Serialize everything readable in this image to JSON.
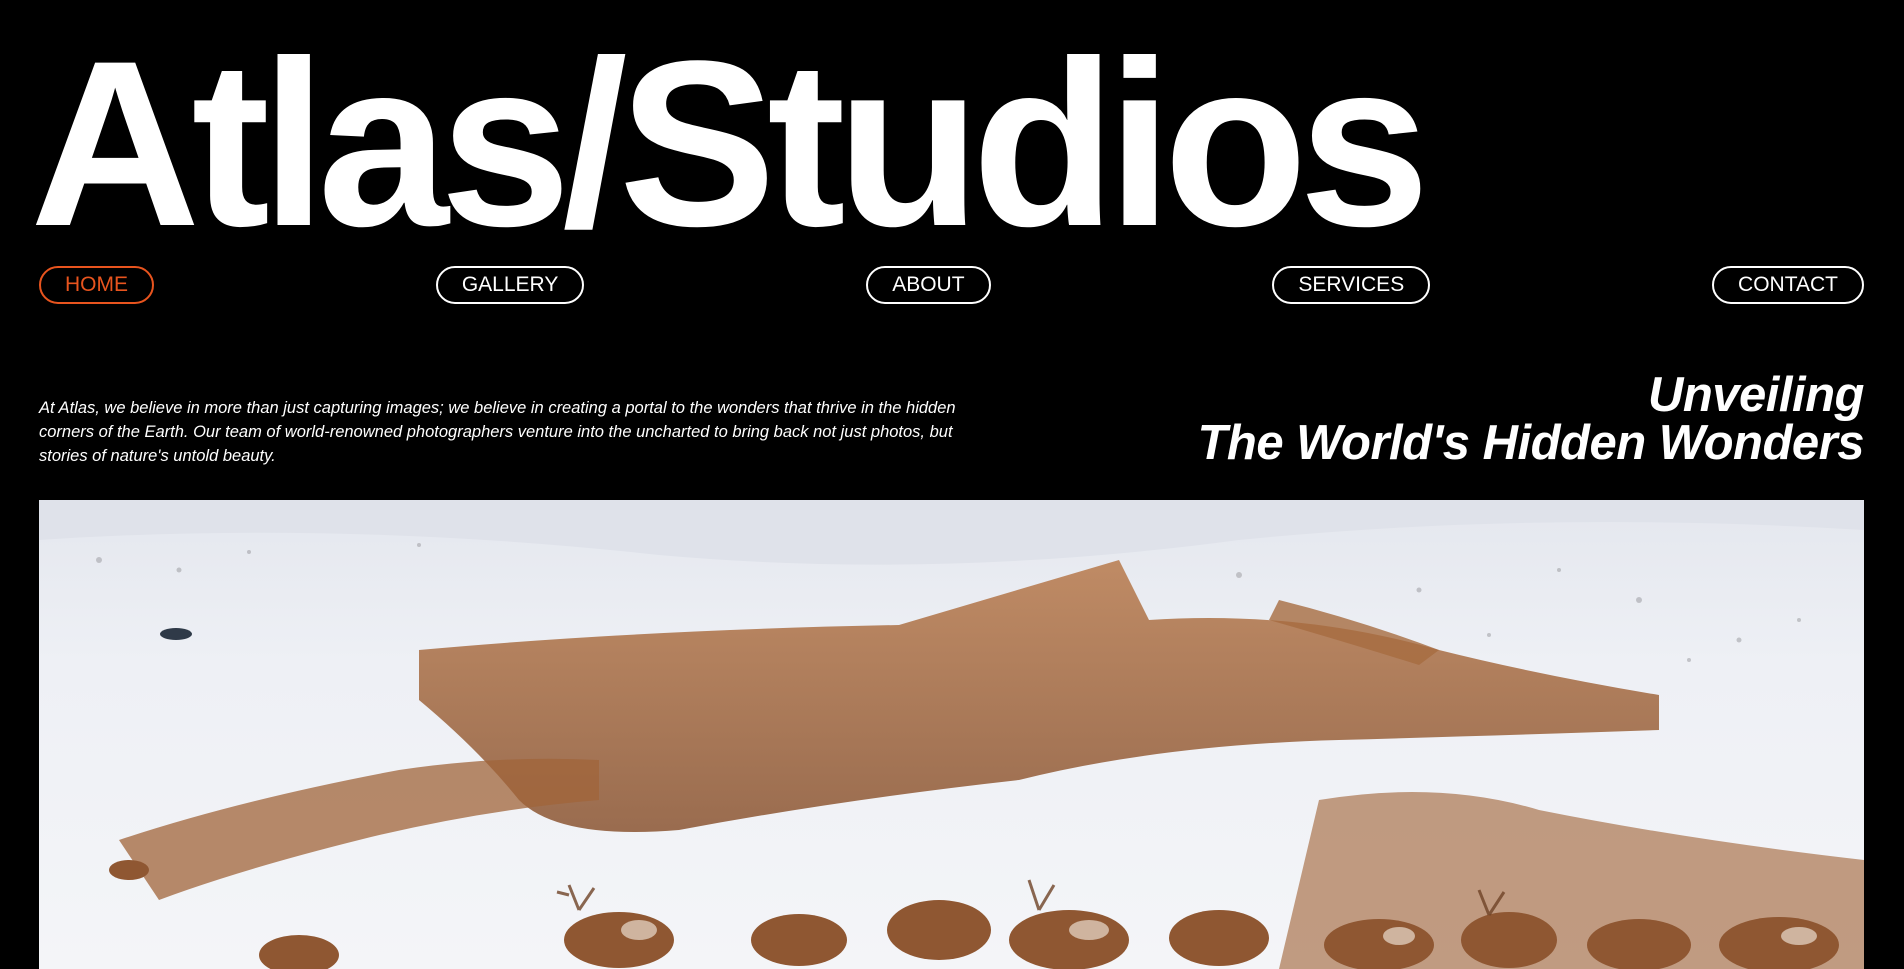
{
  "brand": {
    "logo_text": "Atlas/Studios"
  },
  "theme": {
    "background": "#000000",
    "text": "#ffffff",
    "accent": "#e8541e"
  },
  "nav": {
    "active": "HOME",
    "items": [
      {
        "label": "HOME"
      },
      {
        "label": "GALLERY"
      },
      {
        "label": "ABOUT"
      },
      {
        "label": "SERVICES"
      },
      {
        "label": "CONTACT"
      }
    ]
  },
  "intro": {
    "text": "At Atlas, we believe in more than just capturing images; we believe in creating a portal to the wonders that thrive in the hidden corners of the Earth. Our team of world-renowned photographers venture into the uncharted to bring back not just photos, but stories of nature's untold beauty."
  },
  "headline": {
    "line1": "Unveiling",
    "line2": "The World's Hidden Wonders"
  },
  "hero": {
    "subject": "Aerial photo of a large reindeer herd moving across a snowy tundra"
  }
}
